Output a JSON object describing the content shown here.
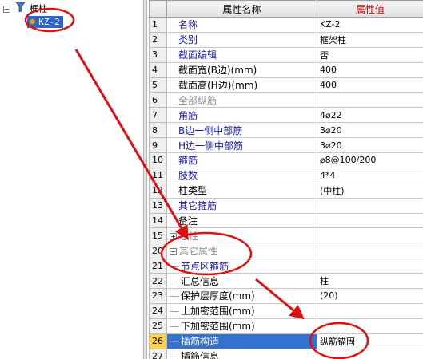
{
  "tree": {
    "root_label": "框柱",
    "child_label": "KZ-2"
  },
  "grid": {
    "header_property": "属性名称",
    "header_value": "属性值",
    "rows": [
      {
        "num": "1",
        "name": "名称",
        "value": "KZ-2",
        "style": "blue"
      },
      {
        "num": "2",
        "name": "类别",
        "value": "框架柱",
        "style": "blue"
      },
      {
        "num": "3",
        "name": "截面编辑",
        "value": "否",
        "style": "blue"
      },
      {
        "num": "4",
        "name": "截面宽(B边)(mm)",
        "value": "400",
        "style": "black"
      },
      {
        "num": "5",
        "name": "截面高(H边)(mm)",
        "value": "400",
        "style": "black"
      },
      {
        "num": "6",
        "name": "全部纵筋",
        "value": "",
        "style": "gray"
      },
      {
        "num": "7",
        "name": "角筋",
        "value": "4⌀22",
        "style": "blue"
      },
      {
        "num": "8",
        "name": "B边一侧中部筋",
        "value": "3⌀20",
        "style": "blue"
      },
      {
        "num": "9",
        "name": "H边一侧中部筋",
        "value": "3⌀20",
        "style": "blue"
      },
      {
        "num": "10",
        "name": "箍筋",
        "value": "⌀8@100/200",
        "style": "blue"
      },
      {
        "num": "11",
        "name": "肢数",
        "value": "4*4",
        "style": "blue"
      },
      {
        "num": "12",
        "name": "柱类型",
        "value": "(中柱)",
        "style": "black"
      },
      {
        "num": "13",
        "name": "其它箍筋",
        "value": "",
        "style": "blue"
      },
      {
        "num": "14",
        "name": "备注",
        "value": "",
        "style": "black"
      },
      {
        "num": "15",
        "name": "芯柱",
        "value": "",
        "style": "gray",
        "expander": "+"
      },
      {
        "num": "20",
        "name": "其它属性",
        "value": "",
        "style": "gray",
        "expander": "−"
      },
      {
        "num": "21",
        "name": "节点区箍筋",
        "value": "",
        "style": "blue",
        "child": true
      },
      {
        "num": "22",
        "name": "汇总信息",
        "value": "柱",
        "style": "black",
        "child": true
      },
      {
        "num": "23",
        "name": "保护层厚度(mm)",
        "value": "(20)",
        "style": "black",
        "child": true
      },
      {
        "num": "24",
        "name": "上加密范围(mm)",
        "value": "",
        "style": "black",
        "child": true
      },
      {
        "num": "25",
        "name": "下加密范围(mm)",
        "value": "",
        "style": "black",
        "child": true
      },
      {
        "num": "26",
        "name": "插筋构造",
        "value": "纵筋锚固",
        "style": "sel",
        "child": true
      },
      {
        "num": "27",
        "name": "插筋信息",
        "value": "",
        "style": "black",
        "child": true
      }
    ]
  },
  "colors": {
    "annotation": "#e01010",
    "selection": "#3472d2",
    "value_header": "#c00000"
  }
}
